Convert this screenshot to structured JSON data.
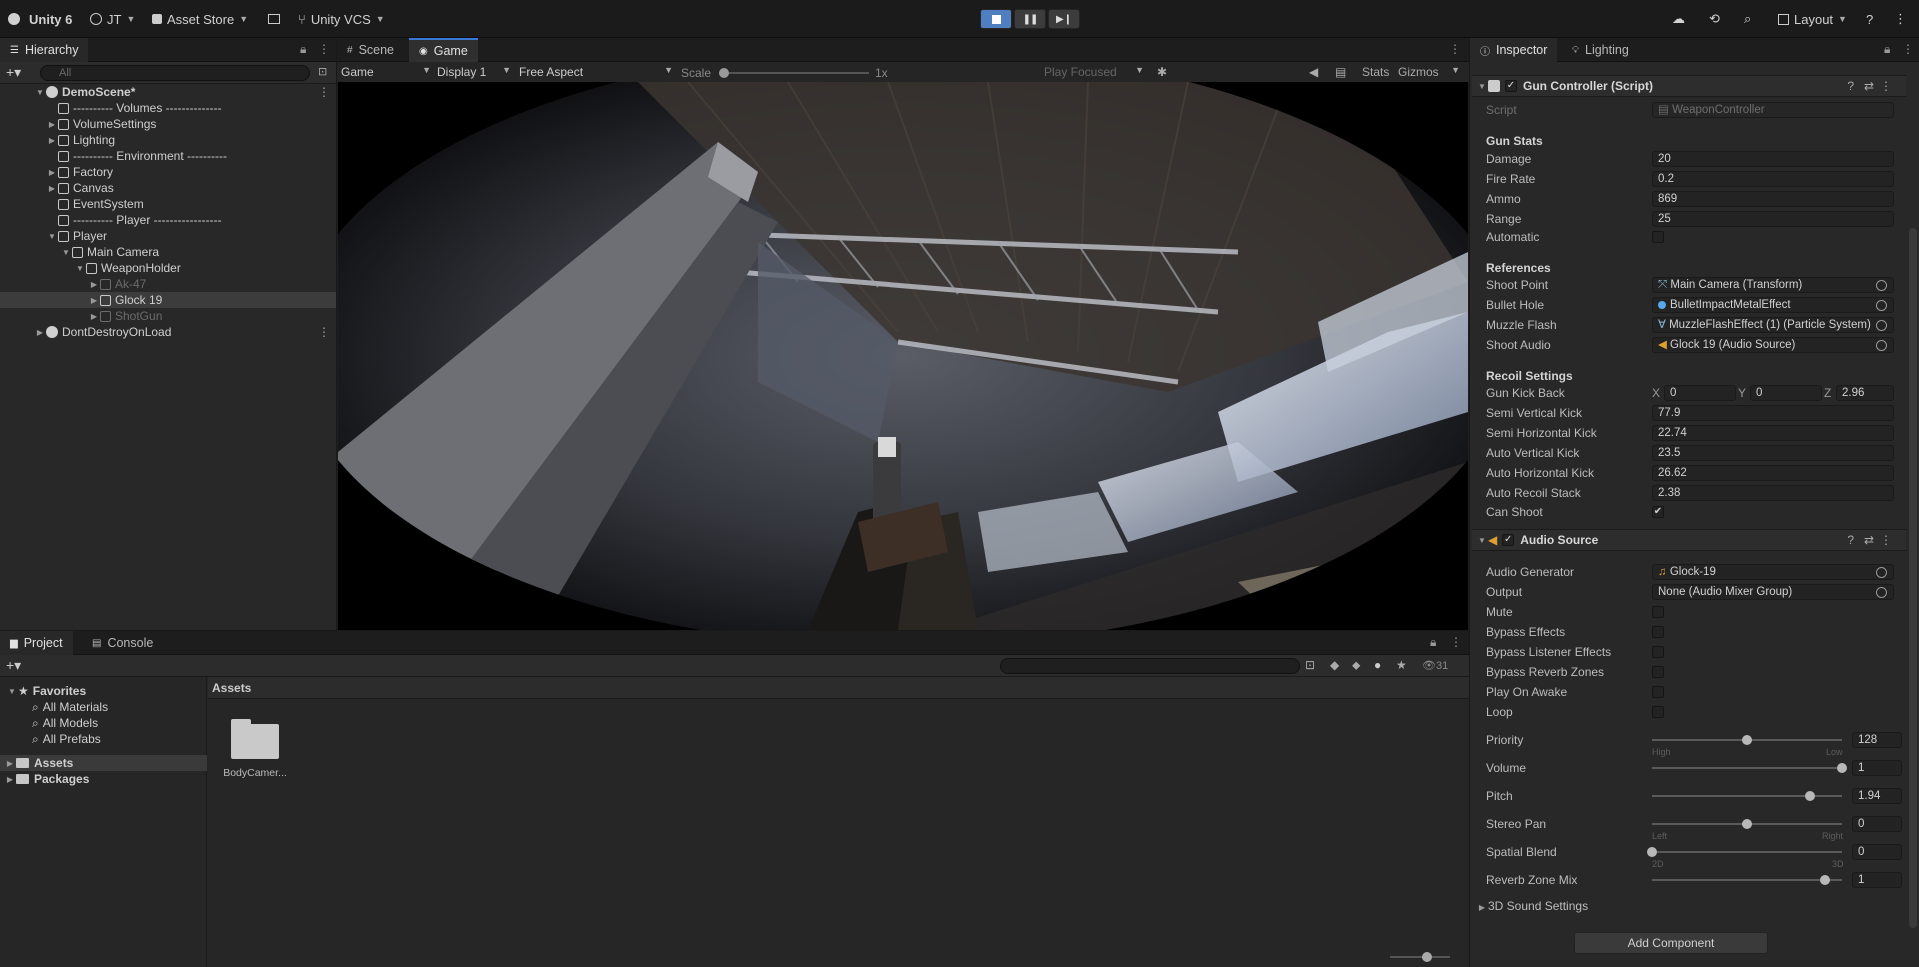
{
  "toolbar": {
    "unity": "Unity 6",
    "account": "JT",
    "asset_store": "Asset Store",
    "vcs": "Unity VCS",
    "layout": "Layout"
  },
  "hierarchy": {
    "tab": "Hierarchy",
    "search_placeholder": "All",
    "items": [
      {
        "label": "DemoScene*"
      },
      {
        "label": "---------- Volumes --------------"
      },
      {
        "label": "VolumeSettings"
      },
      {
        "label": "Lighting"
      },
      {
        "label": "---------- Environment ----------"
      },
      {
        "label": "Factory"
      },
      {
        "label": "Canvas"
      },
      {
        "label": "EventSystem"
      },
      {
        "label": "---------- Player -----------------"
      },
      {
        "label": "Player"
      },
      {
        "label": "Main Camera"
      },
      {
        "label": "WeaponHolder"
      },
      {
        "label": "Ak-47"
      },
      {
        "label": "Glock 19"
      },
      {
        "label": "ShotGun"
      },
      {
        "label": "DontDestroyOnLoad"
      }
    ]
  },
  "scene_tabs": {
    "scene": "Scene",
    "game": "Game"
  },
  "game_bar": {
    "mode": "Game",
    "display": "Display 1",
    "aspect": "Free Aspect",
    "scale_label": "Scale",
    "scale_value": "1x",
    "play_focused": "Play Focused",
    "stats": "Stats",
    "gizmos": "Gizmos"
  },
  "project": {
    "tab_project": "Project",
    "tab_console": "Console",
    "favorites": "Favorites",
    "fav_items": [
      "All Materials",
      "All Models",
      "All Prefabs"
    ],
    "assets": "Assets",
    "packages": "Packages",
    "assets_header": "Assets",
    "folder_name": "BodyCamer...",
    "count": "31"
  },
  "inspector": {
    "tab": "Inspector",
    "tab_lighting": "Lighting",
    "gun": {
      "title": "Gun Controller (Script)",
      "script_label": "Script",
      "script_value": "WeaponController",
      "stats_header": "Gun Stats",
      "damage_label": "Damage",
      "damage": "20",
      "firerate_label": "Fire Rate",
      "firerate": "0.2",
      "ammo_label": "Ammo",
      "ammo": "869",
      "range_label": "Range",
      "range": "25",
      "automatic_label": "Automatic",
      "refs_header": "References",
      "shoot_point_label": "Shoot Point",
      "shoot_point": "Main Camera (Transform)",
      "bullet_hole_label": "Bullet Hole",
      "bullet_hole": "BulletImpactMetalEffect",
      "muzzle_label": "Muzzle Flash",
      "muzzle": "MuzzleFlashEffect (1) (Particle System)",
      "shoot_audio_label": "Shoot Audio",
      "shoot_audio": "Glock 19 (Audio Source)",
      "recoil_header": "Recoil Settings",
      "kick_back_label": "Gun Kick Back",
      "kick_x_label": "X",
      "kick_x": "0",
      "kick_y_label": "Y",
      "kick_y": "0",
      "kick_z_label": "Z",
      "kick_z": "2.96",
      "semi_v_label": "Semi Vertical Kick",
      "semi_v": "77.9",
      "semi_h_label": "Semi Horizontal Kick",
      "semi_h": "22.74",
      "auto_v_label": "Auto Vertical Kick",
      "auto_v": "23.5",
      "auto_h_label": "Auto Horizontal Kick",
      "auto_h": "26.62",
      "auto_stack_label": "Auto Recoil Stack",
      "auto_stack": "2.38",
      "can_shoot_label": "Can Shoot",
      "can_shoot_check": "✔"
    },
    "audio": {
      "title": "Audio Source",
      "generator_label": "Audio Generator",
      "generator": "Glock-19",
      "output_label": "Output",
      "output": "None (Audio Mixer Group)",
      "mute": "Mute",
      "bypass_effects": "Bypass Effects",
      "bypass_listener": "Bypass Listener Effects",
      "bypass_reverb": "Bypass Reverb Zones",
      "play_on_awake": "Play On Awake",
      "loop": "Loop",
      "priority_label": "Priority",
      "priority": "128",
      "priority_level": 0.5,
      "priority_low_hint": "High",
      "priority_high_hint": "Low",
      "volume_label": "Volume",
      "volume": "1",
      "volume_level": 1.0,
      "pitch_label": "Pitch",
      "pitch": "1.94",
      "pitch_level": 0.83,
      "pan_label": "Stereo Pan",
      "pan": "0",
      "pan_level": 0.5,
      "pan_left": "Left",
      "pan_right": "Right",
      "spatial_label": "Spatial Blend",
      "spatial": "0",
      "spatial_level": 0.0,
      "spatial_2d": "2D",
      "spatial_3d": "3D",
      "reverb_label": "Reverb Zone Mix",
      "reverb": "1",
      "reverb_level": 0.91,
      "sound3d": "3D Sound Settings"
    },
    "add_component": "Add Component"
  }
}
